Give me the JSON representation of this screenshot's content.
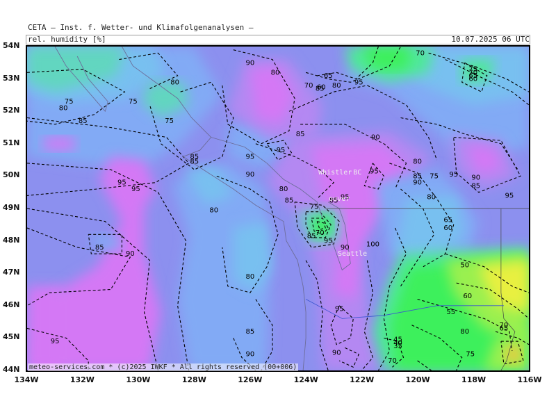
{
  "header": {
    "title": "CETA — Inst. f. Wetter- und Klimafolgenanalysen —",
    "parameter": "rel. humidity [%]",
    "datetime": "10.07.2025 06 UTC"
  },
  "footer": "meteo-services.com * (c)2025 IWKF * All rights reserved (00+006)",
  "axes": {
    "lat_labels": [
      "54N",
      "53N",
      "52N",
      "51N",
      "50N",
      "49N",
      "48N",
      "47N",
      "46N",
      "45N",
      "44N"
    ],
    "lon_labels": [
      "134W",
      "132W",
      "130W",
      "128W",
      "126W",
      "124W",
      "122W",
      "120W",
      "118W",
      "116W"
    ]
  },
  "places": [
    {
      "name": "Whistler",
      "lon": -122.95,
      "lat": 50.12
    },
    {
      "name": "BC",
      "lon": -122.15,
      "lat": 50.12
    },
    {
      "name": "Seattle",
      "lon": -122.33,
      "lat": 47.6
    },
    {
      "name": "ouver",
      "lon": -122.8,
      "lat": 49.3
    }
  ],
  "contour_labels": [
    {
      "text": "70",
      "lon": -119.9,
      "lat": 53.8
    },
    {
      "text": "75",
      "lon": -118.0,
      "lat": 53.3
    },
    {
      "text": "70",
      "lon": -118.0,
      "lat": 53.2
    },
    {
      "text": "65",
      "lon": -118.0,
      "lat": 53.1
    },
    {
      "text": "60",
      "lon": -118.0,
      "lat": 53.0
    },
    {
      "text": "65",
      "lon": -123.2,
      "lat": 53.1
    },
    {
      "text": "60",
      "lon": -123.45,
      "lat": 52.75
    },
    {
      "text": "85",
      "lon": -123.5,
      "lat": 52.7
    },
    {
      "text": "80",
      "lon": -122.9,
      "lat": 52.8
    },
    {
      "text": "95",
      "lon": -122.1,
      "lat": 52.9
    },
    {
      "text": "70",
      "lon": -123.9,
      "lat": 52.8
    },
    {
      "text": "90",
      "lon": -126.0,
      "lat": 53.5
    },
    {
      "text": "80",
      "lon": -125.1,
      "lat": 53.2
    },
    {
      "text": "80",
      "lon": -128.7,
      "lat": 52.9
    },
    {
      "text": "75",
      "lon": -132.5,
      "lat": 52.3
    },
    {
      "text": "80",
      "lon": -132.7,
      "lat": 52.1
    },
    {
      "text": "75",
      "lon": -130.2,
      "lat": 52.3
    },
    {
      "text": "75",
      "lon": -128.9,
      "lat": 51.7
    },
    {
      "text": "85",
      "lon": -132.0,
      "lat": 51.7
    },
    {
      "text": "85",
      "lon": -124.2,
      "lat": 51.3
    },
    {
      "text": "90",
      "lon": -121.5,
      "lat": 51.2
    },
    {
      "text": "95",
      "lon": -124.9,
      "lat": 50.8
    },
    {
      "text": "95",
      "lon": -126.0,
      "lat": 50.6
    },
    {
      "text": "85",
      "lon": -128.0,
      "lat": 50.6
    },
    {
      "text": "85",
      "lon": -128.0,
      "lat": 50.45
    },
    {
      "text": "90",
      "lon": -126.0,
      "lat": 50.05
    },
    {
      "text": "95",
      "lon": -121.55,
      "lat": 50.15
    },
    {
      "text": "80",
      "lon": -120.0,
      "lat": 50.45
    },
    {
      "text": "85",
      "lon": -120.0,
      "lat": 50.0
    },
    {
      "text": "90",
      "lon": -120.0,
      "lat": 49.8
    },
    {
      "text": "75",
      "lon": -119.4,
      "lat": 50.0
    },
    {
      "text": "95",
      "lon": -118.7,
      "lat": 50.05
    },
    {
      "text": "90",
      "lon": -117.9,
      "lat": 49.95
    },
    {
      "text": "85",
      "lon": -117.9,
      "lat": 49.7
    },
    {
      "text": "95",
      "lon": -116.7,
      "lat": 49.4
    },
    {
      "text": "80",
      "lon": -119.5,
      "lat": 49.35
    },
    {
      "text": "95",
      "lon": -130.6,
      "lat": 49.8
    },
    {
      "text": "95",
      "lon": -130.1,
      "lat": 49.6
    },
    {
      "text": "80",
      "lon": -124.8,
      "lat": 49.6
    },
    {
      "text": "85",
      "lon": -124.6,
      "lat": 49.25
    },
    {
      "text": "80",
      "lon": -127.3,
      "lat": 48.95
    },
    {
      "text": "85",
      "lon": -123.0,
      "lat": 49.25
    },
    {
      "text": "95",
      "lon": -122.6,
      "lat": 49.35
    },
    {
      "text": "75",
      "lon": -123.7,
      "lat": 49.05
    },
    {
      "text": "65",
      "lon": -118.9,
      "lat": 48.65
    },
    {
      "text": "60",
      "lon": -118.9,
      "lat": 48.4
    },
    {
      "text": "85",
      "lon": -123.8,
      "lat": 48.15
    },
    {
      "text": "70",
      "lon": -123.5,
      "lat": 48.25
    },
    {
      "text": "95",
      "lon": -123.2,
      "lat": 48.0
    },
    {
      "text": "90",
      "lon": -122.6,
      "lat": 47.8
    },
    {
      "text": "100",
      "lon": -121.6,
      "lat": 47.9
    },
    {
      "text": "85",
      "lon": -131.4,
      "lat": 47.8
    },
    {
      "text": "90",
      "lon": -130.3,
      "lat": 47.6
    },
    {
      "text": "50",
      "lon": -118.3,
      "lat": 47.25
    },
    {
      "text": "80",
      "lon": -126.0,
      "lat": 46.9
    },
    {
      "text": "60",
      "lon": -118.2,
      "lat": 46.3
    },
    {
      "text": "95",
      "lon": -122.8,
      "lat": 45.9
    },
    {
      "text": "55",
      "lon": -118.8,
      "lat": 45.8
    },
    {
      "text": "70",
      "lon": -116.9,
      "lat": 45.4
    },
    {
      "text": "65",
      "lon": -116.9,
      "lat": 45.3
    },
    {
      "text": "85",
      "lon": -126.0,
      "lat": 45.2
    },
    {
      "text": "80",
      "lon": -118.3,
      "lat": 45.2
    },
    {
      "text": "45",
      "lon": -120.7,
      "lat": 44.95
    },
    {
      "text": "40",
      "lon": -120.7,
      "lat": 44.85
    },
    {
      "text": "35",
      "lon": -120.7,
      "lat": 44.75
    },
    {
      "text": "95",
      "lon": -133.0,
      "lat": 44.9
    },
    {
      "text": "90",
      "lon": -126.0,
      "lat": 44.5
    },
    {
      "text": "90",
      "lon": -122.9,
      "lat": 44.55
    },
    {
      "text": "75",
      "lon": -118.1,
      "lat": 44.5
    },
    {
      "text": "70",
      "lon": -120.9,
      "lat": 44.3
    }
  ],
  "colors": {
    "h100": "#d478f5",
    "h95": "#b488f2",
    "h90": "#8c90ef",
    "h85": "#82aaf5",
    "h80": "#78c0f0",
    "h75": "#62d6c0",
    "h70": "#50e89a",
    "h60": "#3ef05c",
    "h50": "#9af050",
    "h40": "#e8f040",
    "h30": "#f0c840",
    "contour": "#000000",
    "coast": "#6d6d9a",
    "border": "#444444"
  }
}
